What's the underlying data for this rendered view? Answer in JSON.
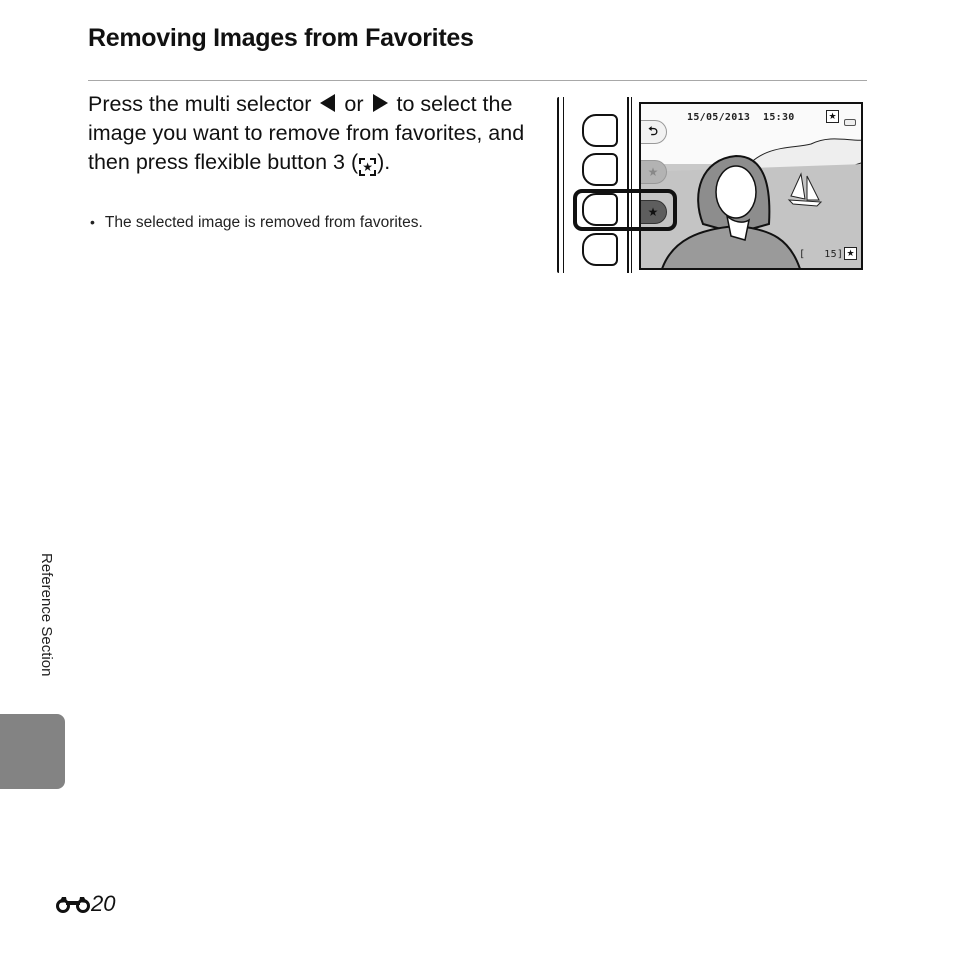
{
  "heading": "Removing Images from Favorites",
  "step": {
    "part1": "Press the multi selector ",
    "or": " or ",
    "part2": " to select the image you want to remove from favorites, and then press flexible button 3 (",
    "part3": ").",
    "left_arrow_icon": "triangle-left",
    "right_arrow_icon": "triangle-right",
    "button_icon": "remove-favorite-icon"
  },
  "bullets": [
    "The selected image is removed from favorites."
  ],
  "camera_screen": {
    "date": "15/05/2013",
    "time": "15:30",
    "frame_counter_open": "[",
    "frame_count": "15",
    "frame_counter_close": "]",
    "flexible_buttons": [
      {
        "index": 1,
        "icon": "return-icon",
        "glyph": "⮌"
      },
      {
        "index": 2,
        "icon": "add-favorite-icon",
        "glyph": "★"
      },
      {
        "index": 3,
        "icon": "remove-favorite-icon",
        "glyph": "★",
        "highlighted": true
      },
      {
        "index": 4,
        "icon": "none",
        "glyph": ""
      }
    ],
    "star_glyph": "★"
  },
  "side_section": "Reference Section",
  "page_number": "20",
  "colors": {
    "section_tab": "#838383",
    "rule": "#a8a8a8",
    "screen_bg": "#c9c9c9"
  }
}
